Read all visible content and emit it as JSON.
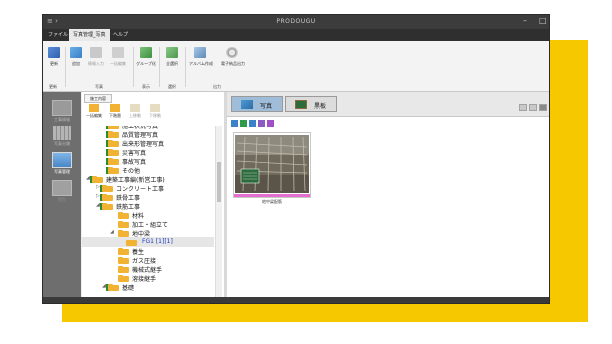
{
  "titlebar": {
    "quick_access": "≡ ›",
    "title": "PRODOUGU",
    "minimize": "–",
    "maximize": "□",
    "close": "×"
  },
  "menubar": {
    "file": "ファイル",
    "photo_management": "写真管理_写真",
    "help": "ヘルプ"
  },
  "ribbon": {
    "buttons": {
      "update": "更新",
      "add": "追加",
      "info_input": "情報入力",
      "batch_edit": "一括編集",
      "group": "グループ化",
      "select_all": "全選択",
      "album": "アルバム作成",
      "e_delivery": "電子納品出力"
    },
    "groups": {
      "update": "更新",
      "photo": "写真",
      "display": "表示",
      "select": "選択",
      "output": "出力"
    }
  },
  "leftnav": {
    "items": [
      {
        "label": "工事情報"
      },
      {
        "label": "写真分類"
      },
      {
        "label": "写真管理"
      },
      {
        "label": "閲覧"
      }
    ]
  },
  "treepane": {
    "tab": "施工内容",
    "toolbar": {
      "batch_edit": "一括編集",
      "bulk_edit2": "下階層",
      "move_up": "上移動",
      "move_down": "下移動"
    },
    "nodes": [
      {
        "label": "施工状況写真",
        "expander": ""
      },
      {
        "label": "品質管理写真",
        "expander": ""
      },
      {
        "label": "出来形管理写真",
        "expander": ""
      },
      {
        "label": "災害写真",
        "expander": ""
      },
      {
        "label": "事故写真",
        "expander": ""
      },
      {
        "label": "その他",
        "expander": ""
      },
      {
        "label": "建築工事編(新営工事)",
        "expander": "◢"
      },
      {
        "label": "コンクリート工事",
        "expander": "▷"
      },
      {
        "label": "鉄骨工事",
        "expander": "▷"
      },
      {
        "label": "鉄筋工事",
        "expander": "◢"
      },
      {
        "label": "材料",
        "expander": ""
      },
      {
        "label": "加工・組立て",
        "expander": ""
      },
      {
        "label": "地中梁",
        "expander": "◢"
      },
      {
        "label": "FG1 [1][1]",
        "expander": ""
      },
      {
        "label": "養生",
        "expander": ""
      },
      {
        "label": "ガス圧接",
        "expander": ""
      },
      {
        "label": "機械式継手",
        "expander": ""
      },
      {
        "label": "溶接継手",
        "expander": ""
      },
      {
        "label": "基礎",
        "expander": "◢"
      }
    ]
  },
  "main": {
    "tabs": [
      {
        "label": "写真"
      },
      {
        "label": "黒板"
      }
    ],
    "photos": [
      {
        "caption": "地中梁配筋"
      }
    ]
  },
  "colors": {
    "accent_yellow": "#f5c800",
    "folder": "#f2b233",
    "folder_edge": "#2e8b2e",
    "selection_bar": "#e46dd0",
    "dark_chrome": "#3c3c3c"
  },
  "icons": {
    "nav": [
      "building-icon",
      "grid-icon",
      "photos-icon",
      "book-icon"
    ],
    "tools": [
      "blue-tool-icon",
      "green-tool-icon",
      "blue-tool-icon",
      "purple-tool-icon",
      "purple-tool-icon"
    ]
  }
}
